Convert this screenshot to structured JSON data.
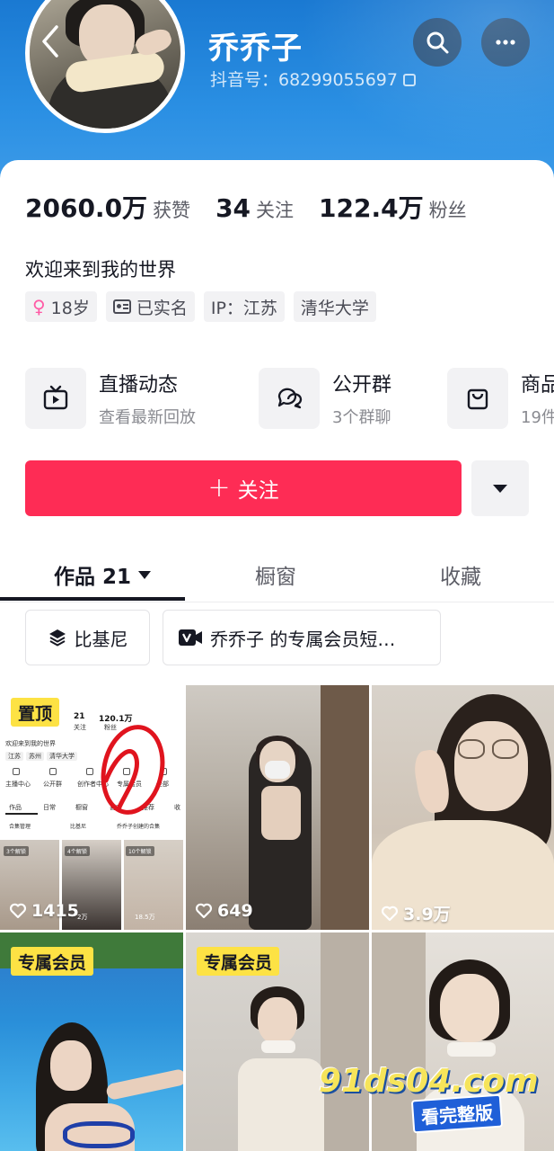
{
  "header": {
    "name": "乔乔子",
    "douyin_id": "抖音号：68299055697"
  },
  "stats": {
    "likes_num": "2060.0万",
    "likes_label": "获赞",
    "following_num": "34",
    "following_label": "关注",
    "followers_num": "122.4万",
    "followers_label": "粉丝"
  },
  "bio": "欢迎来到我的世界",
  "tags": {
    "age": "18岁",
    "verified": "已实名",
    "ip": "IP：江苏",
    "school": "清华大学"
  },
  "features": [
    {
      "title": "直播动态",
      "subtitle": "查看最新回放"
    },
    {
      "title": "公开群",
      "subtitle": "3个群聊"
    },
    {
      "title": "商品",
      "subtitle": "19件"
    }
  ],
  "follow": {
    "label": "关注"
  },
  "tabs": {
    "works": "作品 21",
    "window": "橱窗",
    "favorites": "收藏"
  },
  "collections": [
    {
      "label": "比基尼"
    },
    {
      "label": "乔乔子 的专属会员短…"
    }
  ],
  "grid": {
    "pinned_badge": "置顶",
    "vip_badge": "专属会员",
    "likes": [
      "1415",
      "649",
      "3.9万"
    ]
  },
  "mini": {
    "stat1": "21",
    "stat1_label": "关注",
    "stat2": "120.1万",
    "stat2_label": "粉丝",
    "bio": "欢迎来到我的世界",
    "tags": [
      "江苏",
      "苏州",
      "清华大学"
    ],
    "features": [
      "主播中心",
      "公开群",
      "创作者中心",
      "专属会员",
      "全部"
    ],
    "tabs": [
      "作品",
      "日常",
      "橱窗",
      "喜欢",
      "推荐",
      "收"
    ],
    "coll1": "合集管理",
    "coll2": "比基尼",
    "coll3": "乔乔子创建的合集",
    "chips": [
      "3个解锁",
      "4个解锁",
      "10个解锁"
    ],
    "thumb_likes": [
      "2万",
      "18.5万"
    ]
  },
  "watermark": {
    "url": "91ds04.com",
    "badge": "看完整版"
  },
  "colors": {
    "header_blue": "#2a8fe3",
    "follow_red": "#fe2c55",
    "badge_yellow": "#fde244"
  }
}
